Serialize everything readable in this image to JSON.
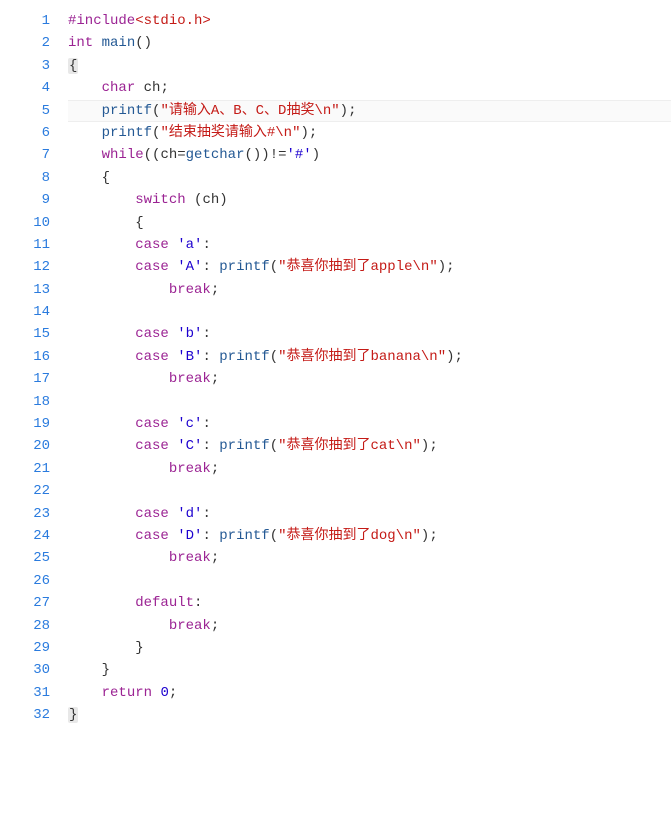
{
  "gutter": {
    "start": 1,
    "end": 32
  },
  "highlight_line": 5,
  "tokens": {
    "include": "#include",
    "header": "<stdio.h>",
    "int": "int",
    "main": "main",
    "char": "char",
    "ch": "ch",
    "printf": "printf",
    "getchar": "getchar",
    "while": "while",
    "switch": "switch",
    "case": "case",
    "break": "break",
    "default": "default",
    "return": "return",
    "zero": "0",
    "lb": "{",
    "rb": "}",
    "lp": "(",
    "rp": ")",
    "semi": ";",
    "colon": ":",
    "comma": ",",
    "eq": "=",
    "neq": "!=",
    "hash": "'#'",
    "a_l": "'a'",
    "a_u": "'A'",
    "b_l": "'b'",
    "b_u": "'B'",
    "c_l": "'c'",
    "c_u": "'C'",
    "d_l": "'d'",
    "d_u": "'D'"
  },
  "strings": {
    "s1a": "\"请输入A、B、C、D抽奖",
    "s1b": "\\n",
    "s1c": "\"",
    "s2a": "\"结束抽奖请输入#",
    "s2b": "\\n",
    "s2c": "\"",
    "apple_a": "\"恭喜你抽到了apple",
    "apple_b": "\\n",
    "apple_c": "\"",
    "banana_a": "\"恭喜你抽到了banana",
    "banana_b": "\\n",
    "banana_c": "\"",
    "cat_a": "\"恭喜你抽到了cat",
    "cat_b": "\\n",
    "cat_c": "\"",
    "dog_a": "\"恭喜你抽到了dog",
    "dog_b": "\\n",
    "dog_c": "\""
  },
  "indent": {
    "i0": "",
    "i1": "    ",
    "i2": "        ",
    "i3": "            ",
    "i4": "                "
  }
}
